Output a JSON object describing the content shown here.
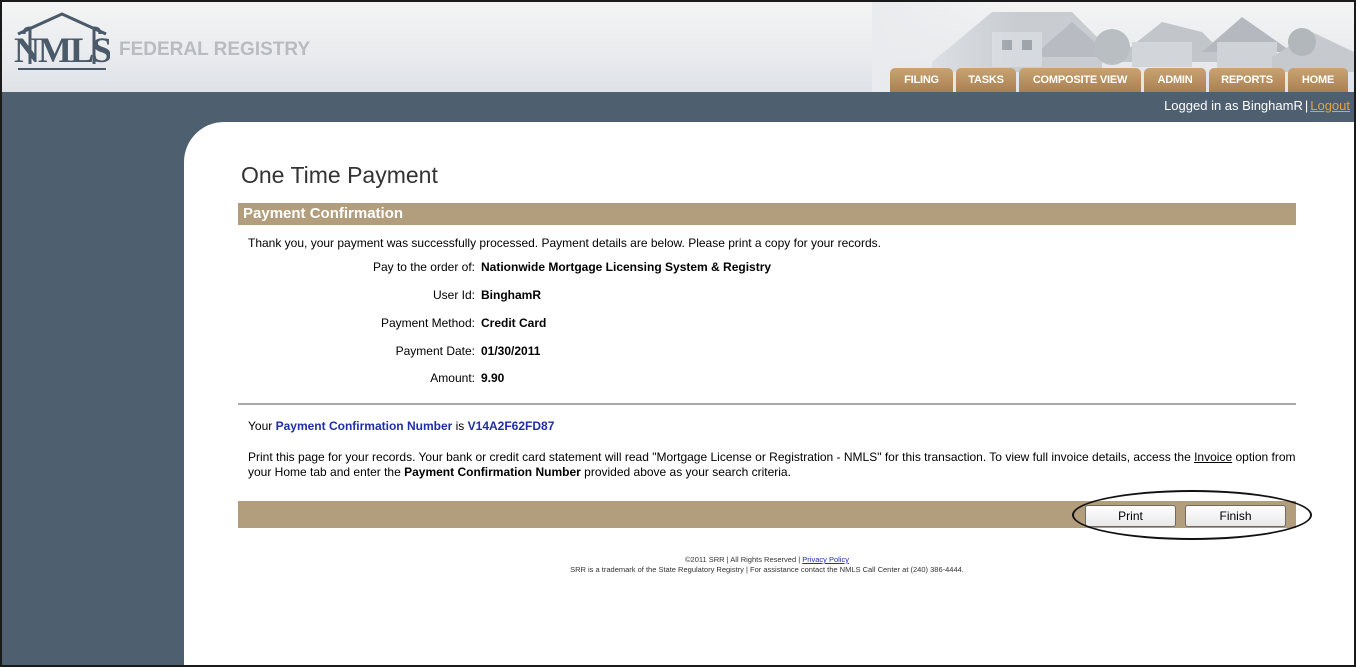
{
  "header": {
    "brand": "FEDERAL REGISTRY",
    "tabs": [
      "FILING",
      "TASKS",
      "COMPOSITE VIEW",
      "ADMIN",
      "REPORTS",
      "HOME"
    ]
  },
  "session": {
    "logged_in_text": "Logged in as BinghamR",
    "separator": "|",
    "logout": "Logout"
  },
  "page": {
    "title": "One Time Payment",
    "section_title": "Payment Confirmation",
    "intro": "Thank you, your payment was successfully processed. Payment details are below. Please print a copy for your records.",
    "details": [
      {
        "label": "Pay to the order of:",
        "value": "Nationwide Mortgage Licensing System & Registry"
      },
      {
        "label": "User Id:",
        "value": "BinghamR"
      },
      {
        "label": "Payment Method:",
        "value": "Credit Card"
      },
      {
        "label": "Payment Date:",
        "value": "01/30/2011"
      },
      {
        "label": "Amount:",
        "value": "9.90"
      }
    ],
    "confirmation": {
      "prefix": "Your",
      "label": "Payment Confirmation Number",
      "is": "is",
      "number": "V14A2F62FD87"
    },
    "note": {
      "part1": "Print this page for your records. Your bank or credit card statement will read \"Mortgage License or Registration - NMLS\" for this transaction. To view full invoice details, access the",
      "invoice_link": "Invoice",
      "part2": "option from your Home tab and enter the",
      "bold": "Payment Confirmation Number",
      "part3": "provided above as your search criteria."
    },
    "buttons": {
      "print": "Print",
      "finish": "Finish"
    }
  },
  "footer": {
    "copyright": "©2011 SRR | All Rights Reserved |",
    "privacy": "Privacy Policy",
    "trademark": "SRR is a trademark of the State Regulatory Registry | For assistance contact the NMLS Call Center at (240) 386-4444."
  },
  "colors": {
    "nav_blue": "#4e5f70",
    "tab_tan": "#b8916a",
    "section_tan": "#b29e7c",
    "link_orange": "#e5a43e",
    "confirm_blue": "#1f2ea8"
  }
}
